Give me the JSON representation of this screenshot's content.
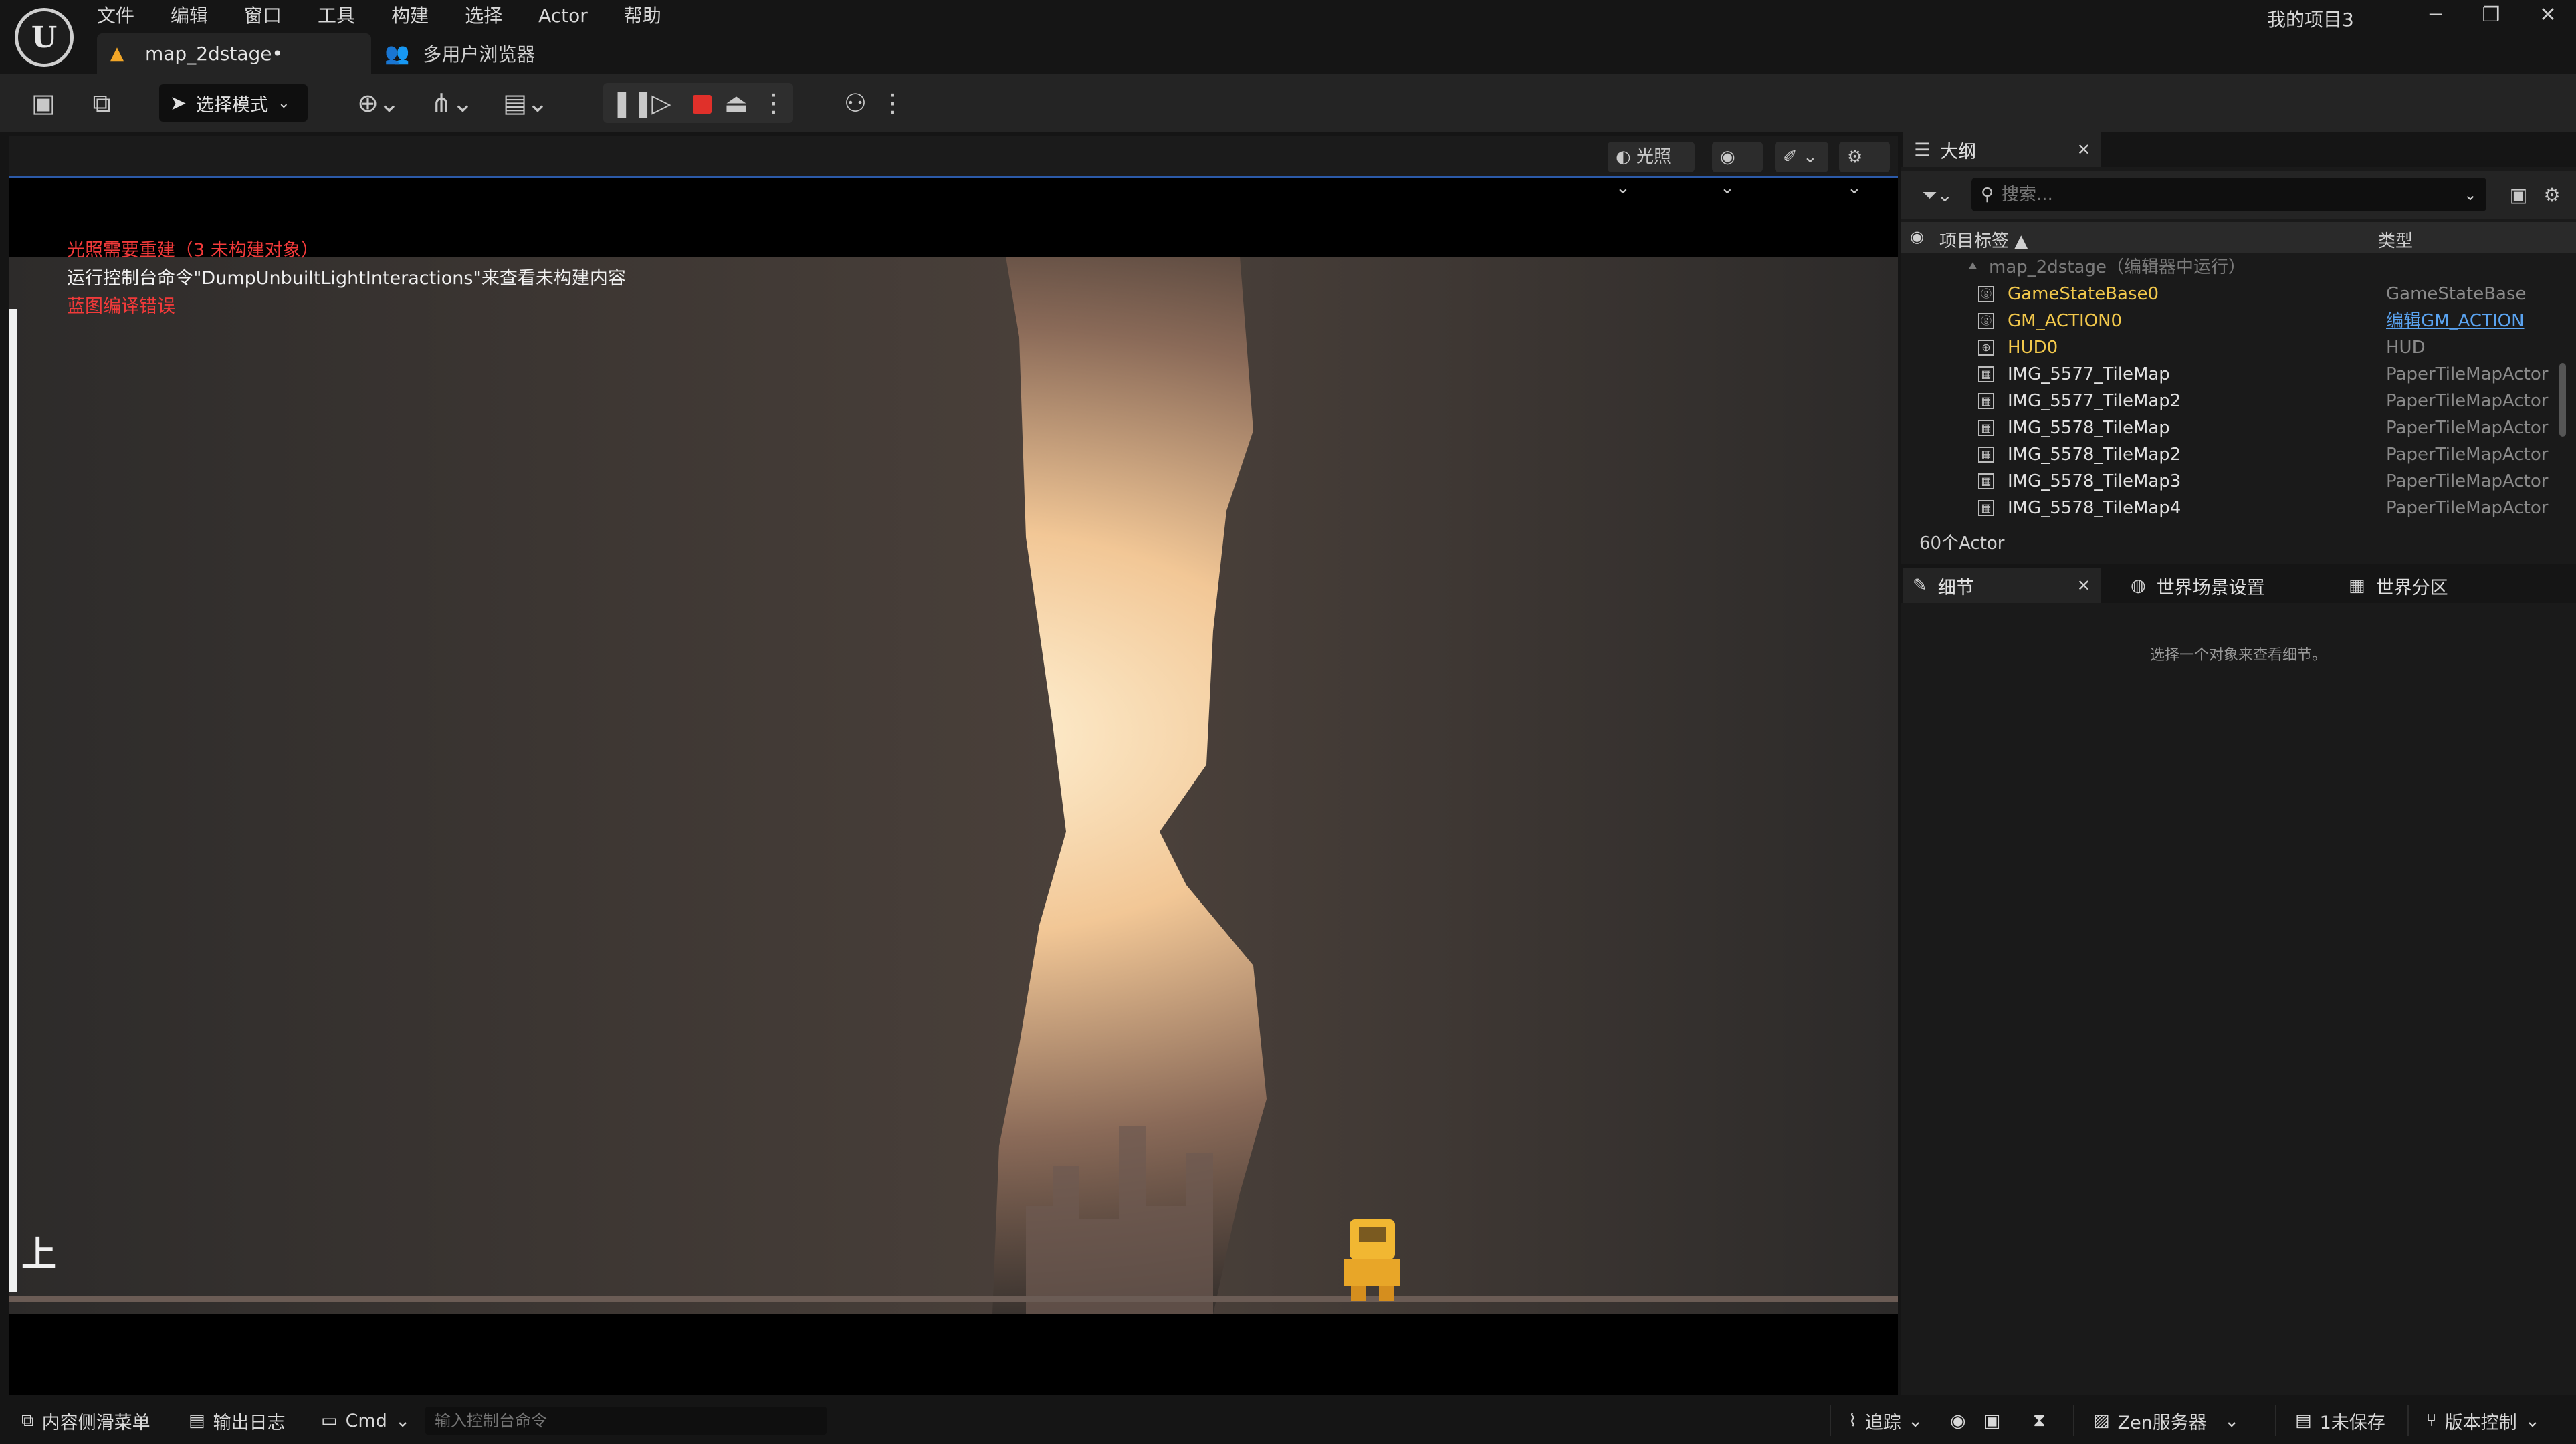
{
  "menu": [
    "文件",
    "编辑",
    "窗口",
    "工具",
    "构建",
    "选择",
    "Actor",
    "帮助"
  ],
  "project_name": "我的项目3",
  "window_controls": {
    "minimize": "─",
    "maximize": "❐",
    "close": "✕"
  },
  "tabs": {
    "level": {
      "label": "map_2dstage•",
      "icon": "level-icon"
    },
    "multiuser": {
      "label": "多用户浏览器",
      "icon": "users-icon"
    }
  },
  "toolbar": {
    "mode_label": "选择模式"
  },
  "viewport": {
    "toolbar": {
      "lighting_label": "光照"
    },
    "messages": [
      {
        "text": "光照需要重建（3 未构建对象）",
        "color": "red"
      },
      {
        "text": "运行控制台命令\"DumpUnbuiltLightInteractions\"来查看未构建内容",
        "color": "white"
      },
      {
        "text": "蓝图编译错误",
        "color": "red"
      }
    ],
    "edge_text": "上"
  },
  "outliner": {
    "tab_label": "大纲",
    "search_placeholder": "搜索...",
    "col_label": "项目标签 ▲",
    "col_type": "类型",
    "world_row": "map_2dstage（编辑器中运行）",
    "rows": [
      {
        "name": "GameStateBase0",
        "type": "GameStateBase",
        "style": "gold",
        "icon": "ⓖ"
      },
      {
        "name": "GM_ACTION0",
        "type": "编辑GM_ACTION",
        "style": "gold",
        "icon": "ⓖ",
        "link": true
      },
      {
        "name": "HUD0",
        "type": "HUD",
        "style": "gold",
        "icon": "⊕"
      },
      {
        "name": "IMG_5577_TileMap",
        "type": "PaperTileMapActor",
        "style": "",
        "icon": "▦"
      },
      {
        "name": "IMG_5577_TileMap2",
        "type": "PaperTileMapActor",
        "style": "",
        "icon": "▦"
      },
      {
        "name": "IMG_5578_TileMap",
        "type": "PaperTileMapActor",
        "style": "",
        "icon": "▦"
      },
      {
        "name": "IMG_5578_TileMap2",
        "type": "PaperTileMapActor",
        "style": "",
        "icon": "▦"
      },
      {
        "name": "IMG_5578_TileMap3",
        "type": "PaperTileMapActor",
        "style": "",
        "icon": "▦"
      },
      {
        "name": "IMG_5578_TileMap4",
        "type": "PaperTileMapActor",
        "style": "",
        "icon": "▦"
      }
    ],
    "actor_count": "60个Actor"
  },
  "details": {
    "tabs": [
      "细节",
      "世界场景设置",
      "世界分区"
    ],
    "hint": "选择一个对象来查看细节。"
  },
  "statusbar": {
    "content_drawer": "内容侧滑菜单",
    "output_log": "输出日志",
    "cmd": "Cmd",
    "console_placeholder": "输入控制台命令",
    "trace": "追踪",
    "zen": "Zen服务器",
    "unsaved": "1未保存",
    "source_control": "版本控制"
  }
}
